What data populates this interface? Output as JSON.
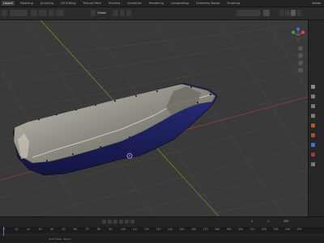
{
  "menu": {
    "workspaces": [
      "Layout",
      "Modeling",
      "Sculpting",
      "UV Editing",
      "Texture Paint",
      "Shading",
      "Animation",
      "Rendering",
      "Compositing",
      "Geometry Nodes",
      "Scripting"
    ],
    "active": "Layout",
    "scene": "Scene"
  },
  "header": {
    "mode": "Object Mode",
    "orientation": "Global",
    "options": "Options"
  },
  "timeline": {
    "ticks": [
      "0",
      "10",
      "20",
      "30",
      "40",
      "50",
      "60",
      "70",
      "80",
      "90",
      "100",
      "110",
      "120",
      "130",
      "140",
      "150",
      "160",
      "170",
      "180",
      "190",
      "200",
      "210",
      "220",
      "230",
      "240",
      "250"
    ],
    "current_frame": "1",
    "start": "1",
    "end": "250"
  },
  "status": {
    "hint": "Orbit View  ·  Select"
  },
  "colors": {
    "viewport_bg": "#3a3a3a",
    "grid_line": "#474747",
    "x_axis": "#8e3a3a",
    "y_axis": "#6a8a2a",
    "pan_outer": "#1c1f66",
    "pan_inner": "#9a978d",
    "accent": "#4a7bd6"
  }
}
